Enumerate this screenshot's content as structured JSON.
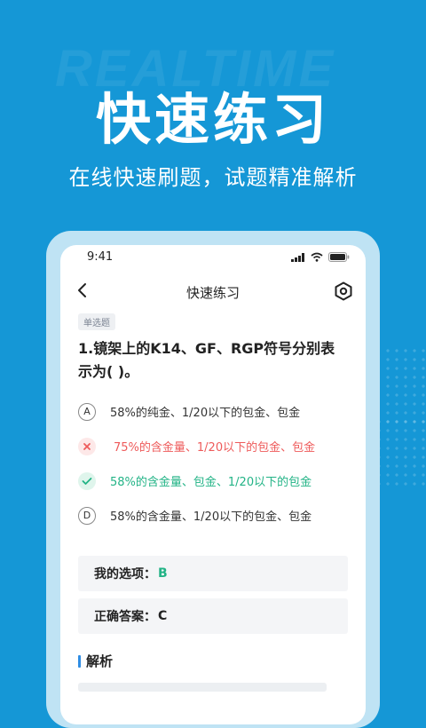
{
  "background": {
    "wordmark": "REALTIME"
  },
  "hero": {
    "title": "快速练习",
    "subtitle": "在线快速刷题，试题精准解析"
  },
  "status_bar": {
    "time": "9:41"
  },
  "nav": {
    "title": "快速练习"
  },
  "question": {
    "type": "单选题",
    "text": "1.镜架上的K14、GF、RGP符号分别表示为( )。",
    "options": [
      {
        "mark": "A",
        "text": "58%的纯金、1/20以下的包金、包金",
        "state": "normal"
      },
      {
        "mark": "✕",
        "text": "75%的含金量、1/20以下的包金、包金",
        "state": "wrong"
      },
      {
        "mark": "✓",
        "text": "58%的含金量、包金、1/20以下的包金",
        "state": "correct"
      },
      {
        "mark": "D",
        "text": "58%的含金量、1/20以下的包金、包金",
        "state": "normal"
      }
    ]
  },
  "answers": {
    "mine_label": "我的选项：",
    "mine_value": "B",
    "correct_label": "正确答案：",
    "correct_value": "C"
  },
  "analysis": {
    "title": "解析"
  },
  "colors": {
    "background": "#1597d6",
    "correct": "#22b386",
    "wrong": "#ee5b5b",
    "accent": "#2f8de4"
  }
}
